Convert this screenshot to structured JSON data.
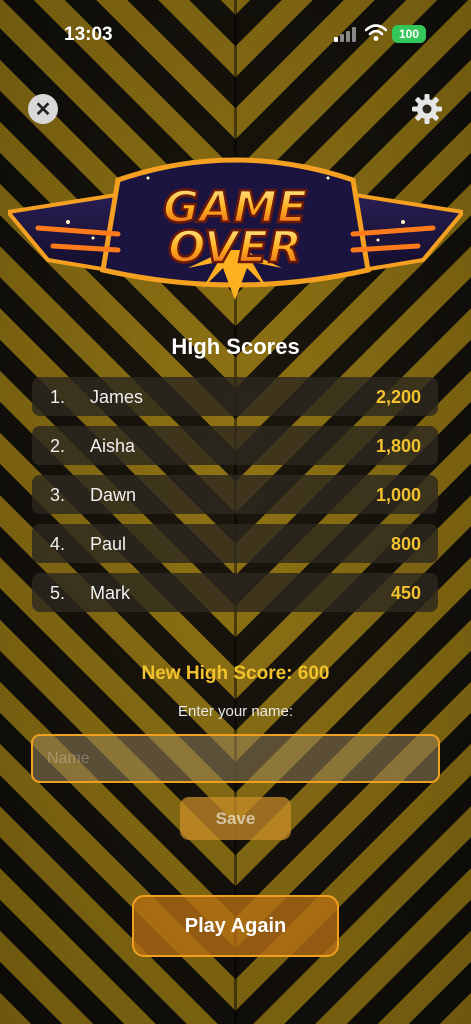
{
  "status_bar": {
    "time": "13:03",
    "battery": "100",
    "battery_color": "#34c759"
  },
  "top_bar": {
    "close_icon": "close-icon",
    "settings_icon": "gear-icon"
  },
  "logo": {
    "line1": "GAME",
    "line2": "OVER"
  },
  "high_scores": {
    "title": "High Scores",
    "entries": [
      {
        "rank": "1.",
        "name": "James",
        "score": "2,200"
      },
      {
        "rank": "2.",
        "name": "Aisha",
        "score": "1,800"
      },
      {
        "rank": "3.",
        "name": "Dawn",
        "score": "1,000"
      },
      {
        "rank": "4.",
        "name": "Paul",
        "score": "800"
      },
      {
        "rank": "5.",
        "name": "Mark",
        "score": "450"
      }
    ]
  },
  "new_score": {
    "label": "New High Score: 600",
    "prompt": "Enter your name:",
    "input_value": "",
    "placeholder": "Name",
    "save_label": "Save"
  },
  "actions": {
    "play_again_label": "Play Again"
  },
  "colors": {
    "accent": "#f2c12e",
    "button_border": "#f0a020",
    "stripe_yellow": "#c7a01a",
    "stripe_dark": "#15130f"
  }
}
